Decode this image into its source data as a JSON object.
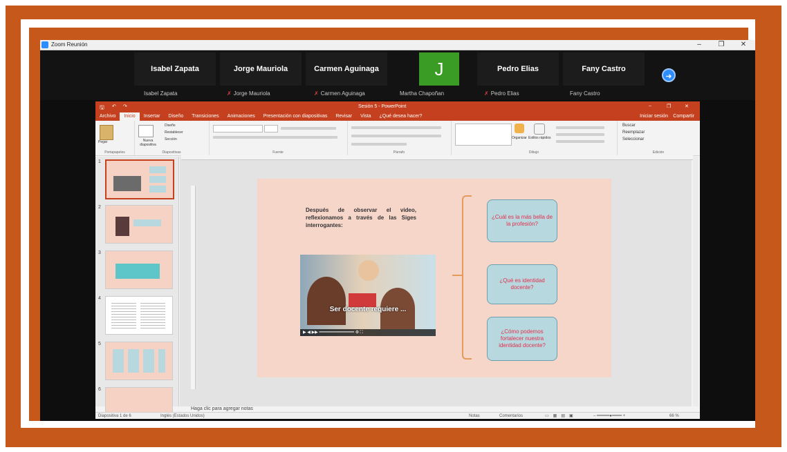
{
  "zoom": {
    "window_title": "Zoom Reunión",
    "controls": [
      "–",
      "❐",
      "✕"
    ],
    "participants": [
      {
        "tile": "Isabel Zapata",
        "label": "Isabel Zapata",
        "muted": false,
        "raised_hand": true
      },
      {
        "tile": "Jorge Mauriola",
        "label": "Jorge Mauriola",
        "muted": true,
        "raised_hand": false
      },
      {
        "tile": "Carmen Aguinaga",
        "label": "Carmen Aguinaga",
        "muted": true,
        "raised_hand": false
      },
      {
        "tile": "J",
        "label": "Martha Chapoñan",
        "muted": false,
        "raised_hand": false,
        "avatar_color": "#3a9c24"
      },
      {
        "tile": "Pedro Elias",
        "label": "Pedro Elias",
        "muted": true,
        "raised_hand": false
      },
      {
        "tile": "Fany Castro",
        "label": "Fany Castro",
        "muted": false,
        "raised_hand": false
      }
    ],
    "next_page_icon": "arrow-right-circle-icon"
  },
  "ppt": {
    "title": "Sesión 5 - PowerPoint",
    "tabs": [
      "Archivo",
      "Inicio",
      "Insertar",
      "Diseño",
      "Transiciones",
      "Animaciones",
      "Presentación con diapositivas",
      "Revisar",
      "Vista",
      "¿Qué desea hacer?"
    ],
    "active_tab": "Inicio",
    "right_actions": [
      "Iniciar sesión",
      "Compartir"
    ],
    "ribbon_groups": [
      "Portapapeles",
      "Diapositivas",
      "Fuente",
      "Párrafo",
      "Dibujo",
      "Edición"
    ],
    "ribbon_buttons": {
      "paste": "Pegar",
      "new_slide": "Nueva diapositiva",
      "layout": "Diseño",
      "reset": "Restablecer",
      "section": "Sección",
      "arrange": "Organizar",
      "quick_styles": "Estilos rápidos",
      "find": "Buscar",
      "replace": "Reemplazar",
      "select": "Seleccionar"
    },
    "thumbnails": [
      "1",
      "2",
      "3",
      "4",
      "5",
      "6"
    ],
    "slide": {
      "text": "Después de observar el video, reflexionamos a través de las Siges interrogantes:",
      "video_caption": "Ser docente requiere ...",
      "questions": [
        "¿Cuál es la más bella de la profesión?",
        "¿Qué es identidad docente?",
        "¿Cómo podemos fortalecer nuestra identidad docente?"
      ]
    },
    "notes_placeholder": "Haga clic para agregar notas",
    "status": {
      "slide_info": "Diapositiva 1 de 6",
      "language": "Inglés (Estados Unidos)",
      "notes_btn": "Notas",
      "comments_btn": "Comentarios",
      "zoom": "66 %"
    }
  }
}
